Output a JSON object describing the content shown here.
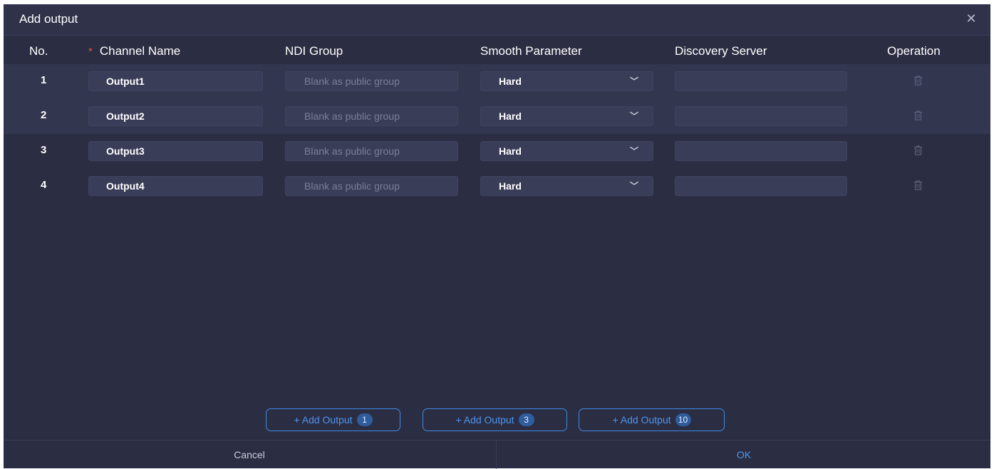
{
  "dialog": {
    "title": "Add output",
    "close_icon": "close-icon"
  },
  "columns": {
    "no": "No.",
    "required_mark": "*",
    "channel_name": "Channel Name",
    "ndi_group": "NDI Group",
    "smooth_parameter": "Smooth Parameter",
    "discovery_server": "Discovery Server",
    "operation": "Operation"
  },
  "rows": [
    {
      "no": "1",
      "channel_name": "Output1",
      "ndi_group": "",
      "ndi_group_placeholder": "Blank as public group",
      "smooth": "Hard",
      "discovery_server": ""
    },
    {
      "no": "2",
      "channel_name": "Output2",
      "ndi_group": "",
      "ndi_group_placeholder": "Blank as public group",
      "smooth": "Hard",
      "discovery_server": ""
    },
    {
      "no": "3",
      "channel_name": "Output3",
      "ndi_group": "",
      "ndi_group_placeholder": "Blank as public group",
      "smooth": "Hard",
      "discovery_server": ""
    },
    {
      "no": "4",
      "channel_name": "Output4",
      "ndi_group": "",
      "ndi_group_placeholder": "Blank as public group",
      "smooth": "Hard",
      "discovery_server": ""
    }
  ],
  "add_buttons": [
    {
      "label": "+ Add Output",
      "count": "1"
    },
    {
      "label": "+ Add Output",
      "count": "3"
    },
    {
      "label": "+ Add Output",
      "count": "10"
    }
  ],
  "footer": {
    "cancel": "Cancel",
    "ok": "OK"
  },
  "colors": {
    "background": "#2b2d42",
    "accent": "#4d96f0",
    "required": "#e05050"
  }
}
